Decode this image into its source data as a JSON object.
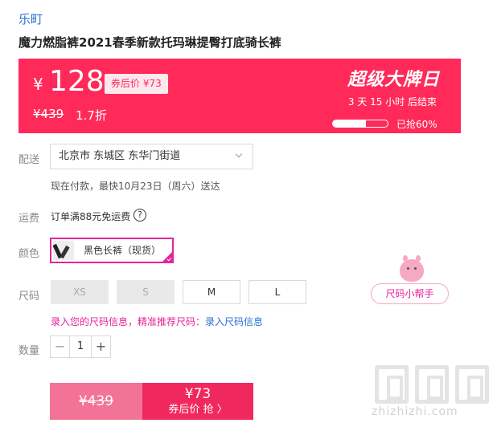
{
  "store": {
    "name": "乐町"
  },
  "product": {
    "title": "魔力燃脂裤2021春季新款托玛琳提臀打底骑长裤"
  },
  "promo": {
    "currency_symbol": "¥",
    "price": "128",
    "coupon_tag": "券后价 ¥73",
    "original_price": "¥439",
    "discount": "1.7折",
    "event_title": "超级大牌日",
    "countdown": "3  天  15 小时 后结束",
    "progress_fraction": 0.6,
    "progress_text": "已抢60%",
    "color": "#ff2a59"
  },
  "delivery": {
    "label": "配送",
    "address": "北京市 东城区 东华门街道",
    "note": "现在付款，最快10月23日（周六）送达"
  },
  "shipping": {
    "label": "运费",
    "text": "订单满88元免运费",
    "help_icon": "?"
  },
  "color_row": {
    "label": "颜色",
    "selected": "黑色长裤（现货）",
    "accent": "#e5239a"
  },
  "size_row": {
    "label": "尺码",
    "options": [
      "XS",
      "S",
      "M",
      "L"
    ],
    "hint_a": "录入您的尺码信息，精准推荐尺码：",
    "hint_b": "录入尺码信息",
    "helper": "尺码小帮手"
  },
  "quantity_row": {
    "label": "数量",
    "minus": "−",
    "value": "1",
    "plus": "+"
  },
  "buy": {
    "left_price": "¥439",
    "right_price": "¥73",
    "right_label": "券后价 抢 〉"
  },
  "watermark": {
    "text": "zhizhizhi.com"
  }
}
